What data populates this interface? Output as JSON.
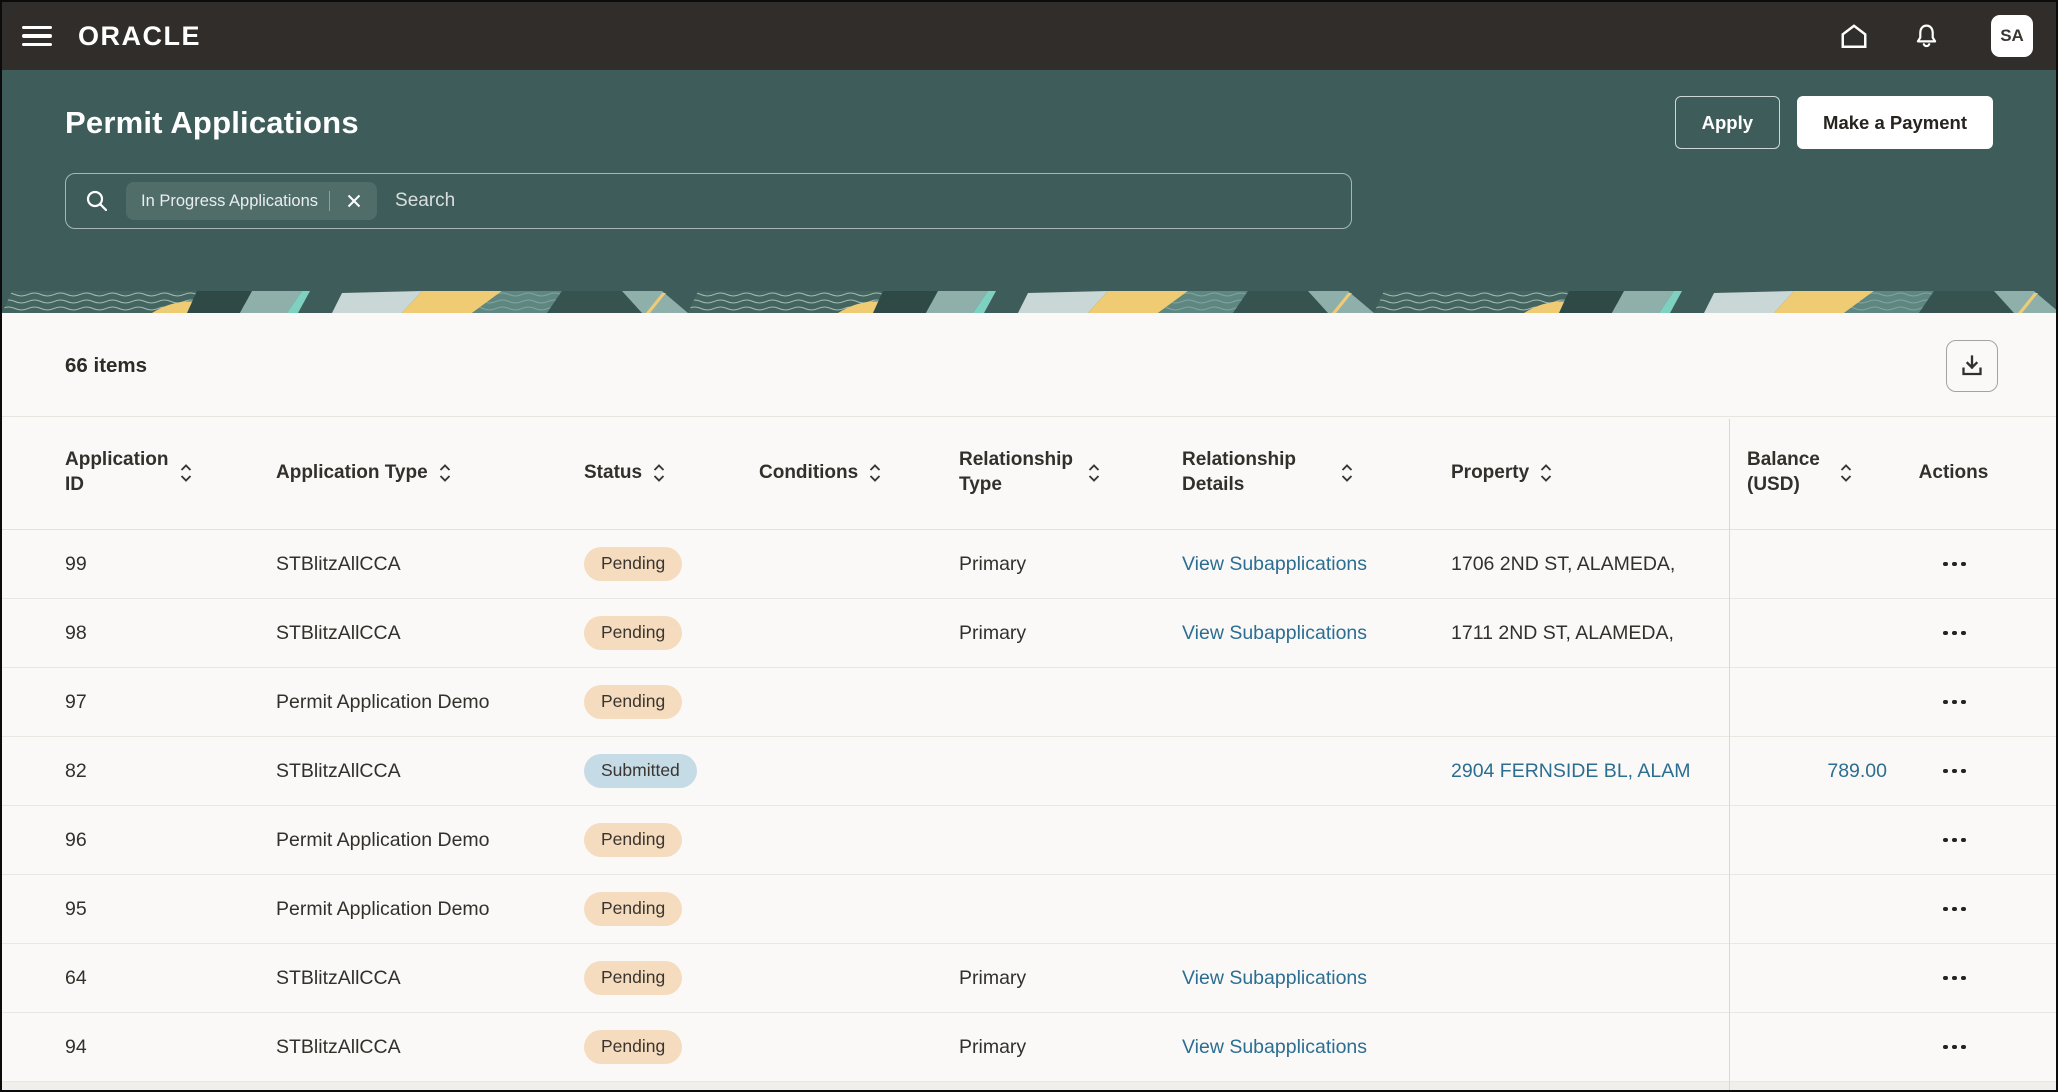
{
  "colors": {
    "topbar_bg": "#312D2A",
    "hero_bg": "#3E5D5A",
    "page_bg": "#FBF9F8",
    "text_dark": "#33302C",
    "link_blue": "#2B6E91",
    "badge_pending_bg": "#F5DCBE",
    "badge_submitted_bg": "#C5DBE6",
    "banner_yellow": "#EFCB74",
    "banner_teal_light": "#8FAFAA",
    "banner_mint": "#7ED0C0"
  },
  "topbar": {
    "brand": "ORACLE",
    "avatar_initials": "SA"
  },
  "hero": {
    "title": "Permit Applications",
    "apply_label": "Apply",
    "make_payment_label": "Make a Payment",
    "search": {
      "filter_chip": "In Progress Applications",
      "placeholder": "Search"
    }
  },
  "toolbar": {
    "items_count": "66 items"
  },
  "table": {
    "columns": [
      {
        "label": "Application ID",
        "sortable": true
      },
      {
        "label": "Application Type",
        "sortable": true
      },
      {
        "label": "Status",
        "sortable": true
      },
      {
        "label": "Conditions",
        "sortable": true
      },
      {
        "label": "Relationship Type",
        "sortable": true
      },
      {
        "label": "Relationship Details",
        "sortable": true
      },
      {
        "label": "Property",
        "sortable": true
      },
      {
        "label": "Balance (USD)",
        "sortable": true
      },
      {
        "label": "Actions",
        "sortable": false
      }
    ],
    "rows": [
      {
        "id": "99",
        "type": "STBlitzAllCCA",
        "status": "Pending",
        "status_kind": "pending",
        "conditions": "",
        "relationship_type": "Primary",
        "relationship_details": "View Subapplications",
        "property": "1706 2ND ST, ALAMEDA,",
        "property_link": false,
        "balance": ""
      },
      {
        "id": "98",
        "type": "STBlitzAllCCA",
        "status": "Pending",
        "status_kind": "pending",
        "conditions": "",
        "relationship_type": "Primary",
        "relationship_details": "View Subapplications",
        "property": "1711 2ND ST, ALAMEDA,",
        "property_link": false,
        "balance": ""
      },
      {
        "id": "97",
        "type": "Permit Application Demo",
        "status": "Pending",
        "status_kind": "pending",
        "conditions": "",
        "relationship_type": "",
        "relationship_details": "",
        "property": "",
        "property_link": false,
        "balance": ""
      },
      {
        "id": "82",
        "type": "STBlitzAllCCA",
        "status": "Submitted",
        "status_kind": "submitted",
        "conditions": "",
        "relationship_type": "",
        "relationship_details": "",
        "property": "2904 FERNSIDE BL, ALAM",
        "property_link": true,
        "balance": "789.00"
      },
      {
        "id": "96",
        "type": "Permit Application Demo",
        "status": "Pending",
        "status_kind": "pending",
        "conditions": "",
        "relationship_type": "",
        "relationship_details": "",
        "property": "",
        "property_link": false,
        "balance": ""
      },
      {
        "id": "95",
        "type": "Permit Application Demo",
        "status": "Pending",
        "status_kind": "pending",
        "conditions": "",
        "relationship_type": "",
        "relationship_details": "",
        "property": "",
        "property_link": false,
        "balance": ""
      },
      {
        "id": "64",
        "type": "STBlitzAllCCA",
        "status": "Pending",
        "status_kind": "pending",
        "conditions": "",
        "relationship_type": "Primary",
        "relationship_details": "View Subapplications",
        "property": "",
        "property_link": false,
        "balance": ""
      },
      {
        "id": "94",
        "type": "STBlitzAllCCA",
        "status": "Pending",
        "status_kind": "pending",
        "conditions": "",
        "relationship_type": "Primary",
        "relationship_details": "View Subapplications",
        "property": "",
        "property_link": false,
        "balance": ""
      }
    ]
  }
}
